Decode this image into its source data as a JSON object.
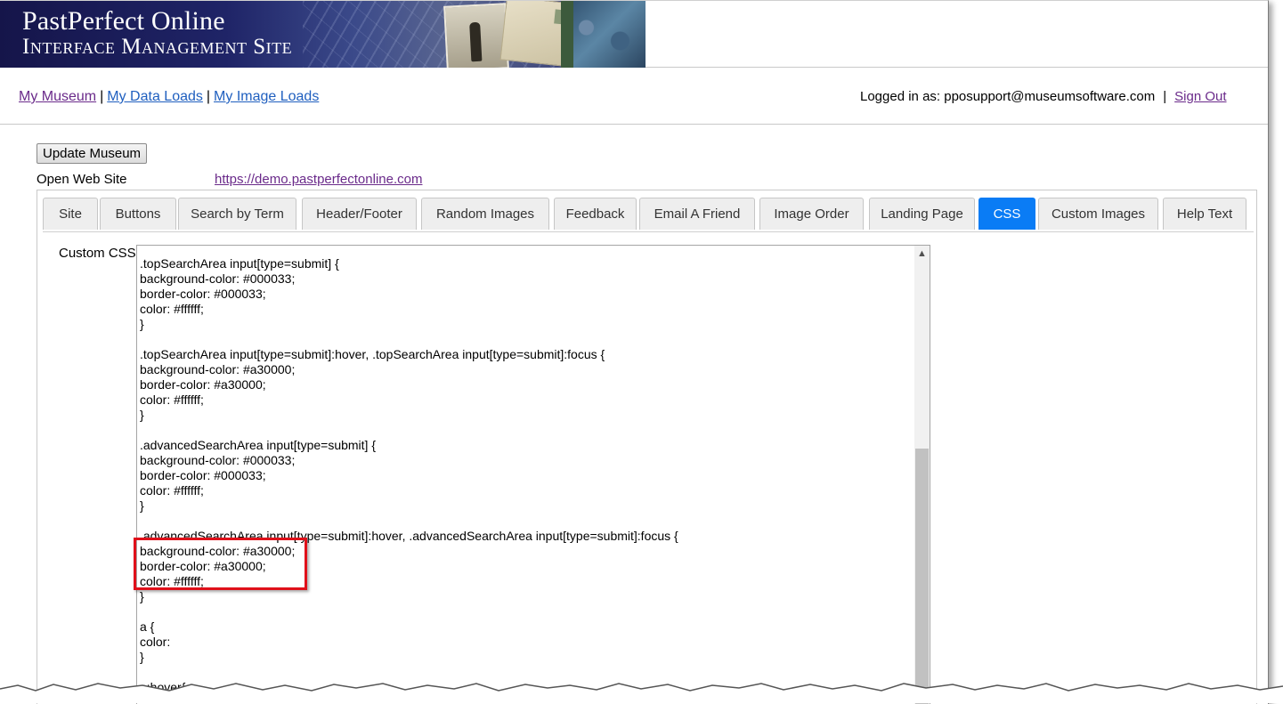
{
  "header": {
    "title_line1": "PastPerfect Online",
    "title_line2": "Interface Management Site"
  },
  "nav": {
    "links": [
      "My Museum",
      "My Data Loads",
      "My Image Loads"
    ],
    "separator": "|"
  },
  "login": {
    "text": "Logged in as: pposupport@museumsoftware.com",
    "separator": "|",
    "sign_out": "Sign Out"
  },
  "toolbar": {
    "update_label": "Update Museum",
    "open_site_label": "Open Web Site",
    "site_url": "https://demo.pastperfectonline.com"
  },
  "tabs": [
    {
      "label": "Site",
      "active": false
    },
    {
      "label": "Buttons",
      "active": false
    },
    {
      "label": "Search by Term",
      "active": false
    },
    {
      "label": "Header/Footer",
      "active": false
    },
    {
      "label": "Random Images",
      "active": false
    },
    {
      "label": "Feedback",
      "active": false
    },
    {
      "label": "Email A Friend",
      "active": false
    },
    {
      "label": "Image Order",
      "active": false
    },
    {
      "label": "Landing Page",
      "active": false
    },
    {
      "label": "CSS",
      "active": true
    },
    {
      "label": "Custom Images",
      "active": false
    },
    {
      "label": "Help Text",
      "active": false
    }
  ],
  "css_editor": {
    "label": "Custom CSS",
    "content": ".topSearchArea input[type=submit] {\nbackground-color: #000033;\nborder-color: #000033;\ncolor: #ffffff;\n}\n\n.topSearchArea input[type=submit]:hover, .topSearchArea input[type=submit]:focus {\nbackground-color: #a30000;\nborder-color: #a30000;\ncolor: #ffffff;\n}\n\n.advancedSearchArea input[type=submit] {\nbackground-color: #000033;\nborder-color: #000033;\ncolor: #ffffff;\n}\n\n.advancedSearchArea input[type=submit]:hover, .advancedSearchArea input[type=submit]:focus {\nbackground-color: #a30000;\nborder-color: #a30000;\ncolor: #ffffff;\n}\n\na {\ncolor:\n}\n\na:hover{"
  },
  "colors": {
    "active_tab": "#0a7cf5",
    "highlight_box": "#e0101a",
    "banner": "#1f2467"
  }
}
